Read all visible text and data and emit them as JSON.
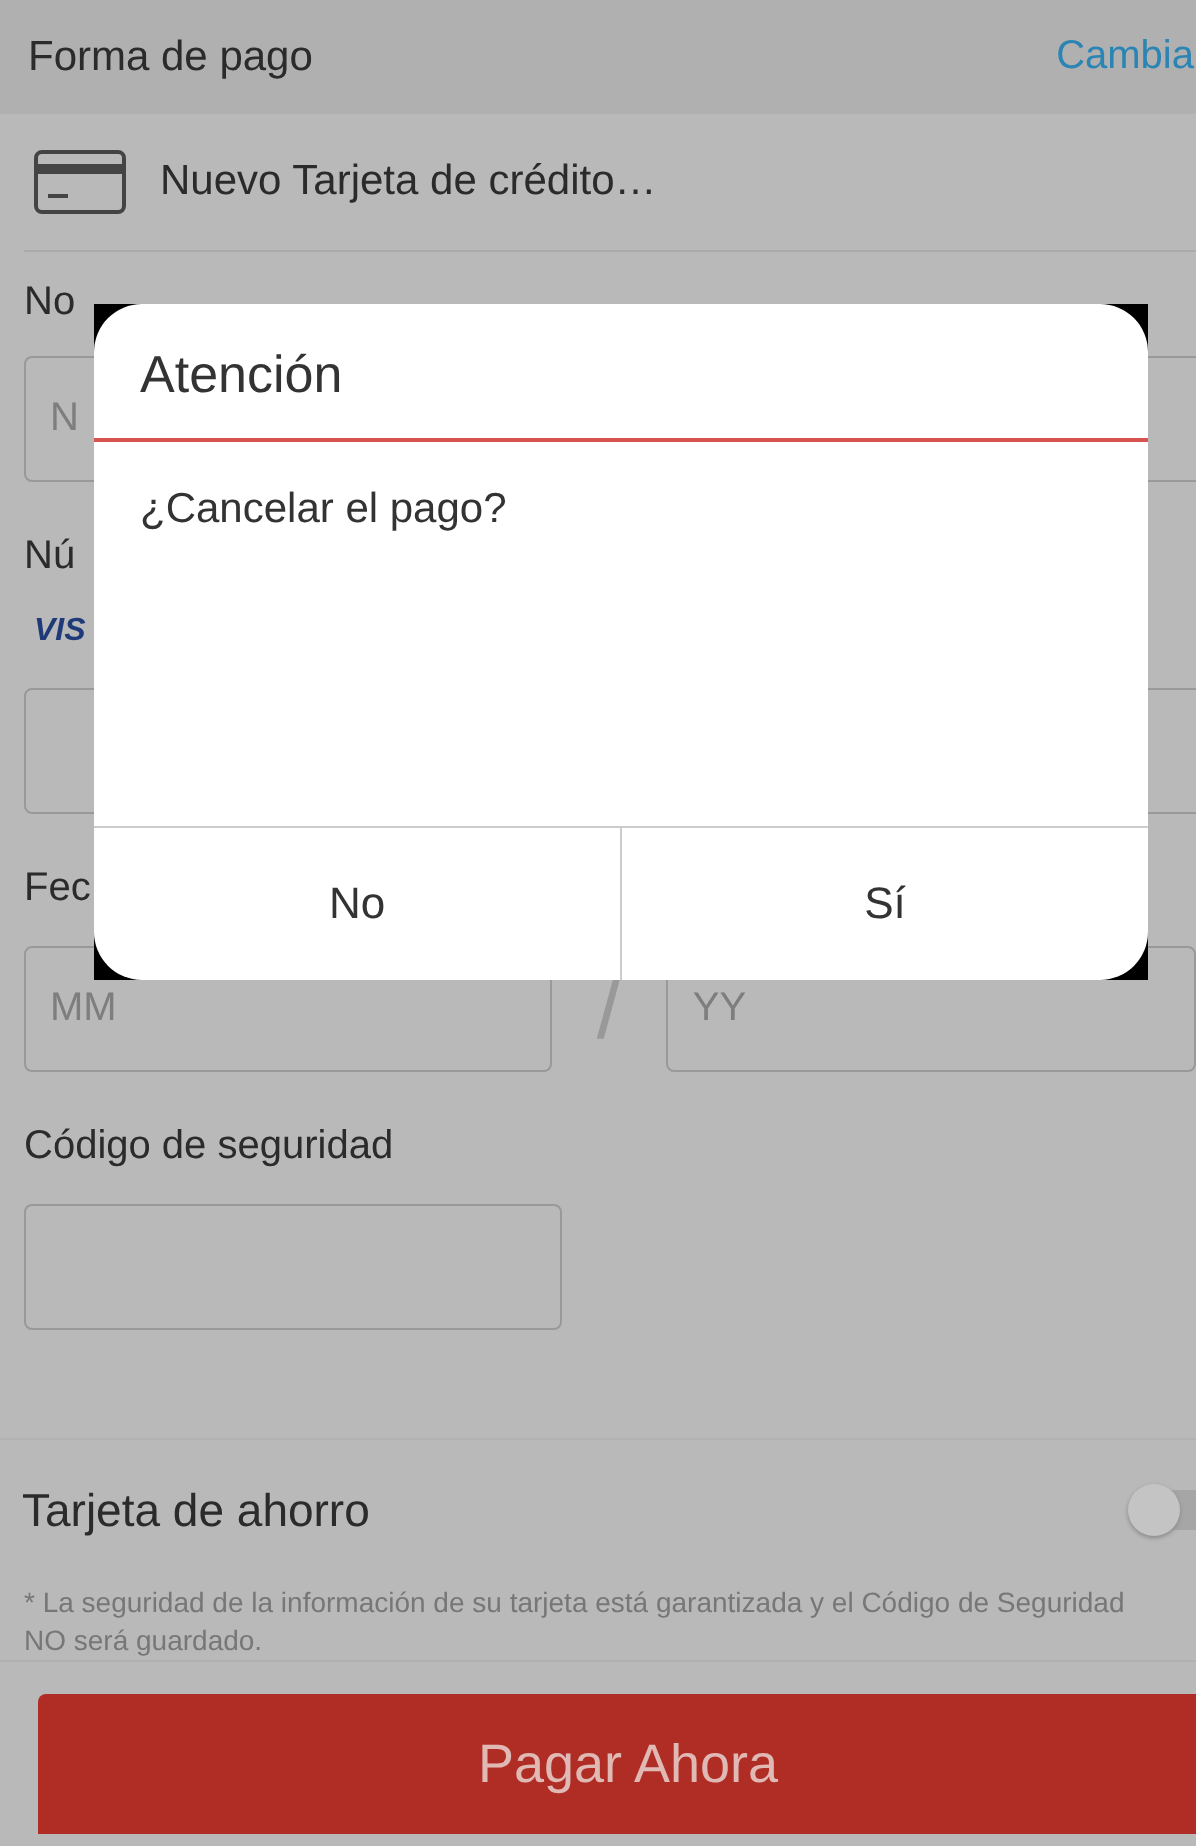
{
  "header": {
    "title": "Forma de pago",
    "action": "Cambia"
  },
  "payment_method": {
    "label": "Nuevo Tarjeta de crédito…"
  },
  "form": {
    "holder_label": "No",
    "holder_placeholder": "N",
    "number_label": "Nú",
    "card_brand": "VIS",
    "expiry_label": "Fec",
    "month_placeholder": "MM",
    "separator": "/",
    "year_placeholder": "YY",
    "security_label": "Código de seguridad"
  },
  "savings_card": {
    "label": "Tarjeta de ahorro",
    "on": false
  },
  "note": "* La seguridad de la información de su tarjeta está garantizada y el Código de Seguridad NO será guardado.",
  "pay_button": "Pagar Ahora",
  "dialog": {
    "title": "Atención",
    "message": "¿Cancelar el pago?",
    "buttons": [
      {
        "label": "No"
      },
      {
        "label": "Sí"
      }
    ]
  }
}
